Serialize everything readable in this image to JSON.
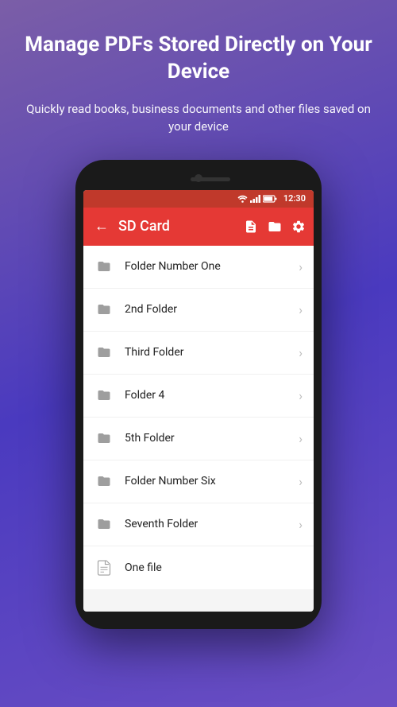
{
  "hero": {
    "title": "Manage PDFs Stored Directly on Your Device",
    "subtitle": "Quickly read books, business documents and other files saved on your device"
  },
  "statusBar": {
    "time": "12:30"
  },
  "appBar": {
    "title": "SD Card",
    "backLabel": "←"
  },
  "fileList": [
    {
      "name": "Folder Number One",
      "type": "folder"
    },
    {
      "name": "2nd Folder",
      "type": "folder"
    },
    {
      "name": "Third Folder",
      "type": "folder"
    },
    {
      "name": "Folder 4",
      "type": "folder"
    },
    {
      "name": "5th Folder",
      "type": "folder"
    },
    {
      "name": "Folder Number Six",
      "type": "folder"
    },
    {
      "name": "Seventh Folder",
      "type": "folder"
    },
    {
      "name": "One file",
      "type": "file"
    }
  ],
  "colors": {
    "appBarRed": "#e53935",
    "statusBarRed": "#c0392b"
  }
}
